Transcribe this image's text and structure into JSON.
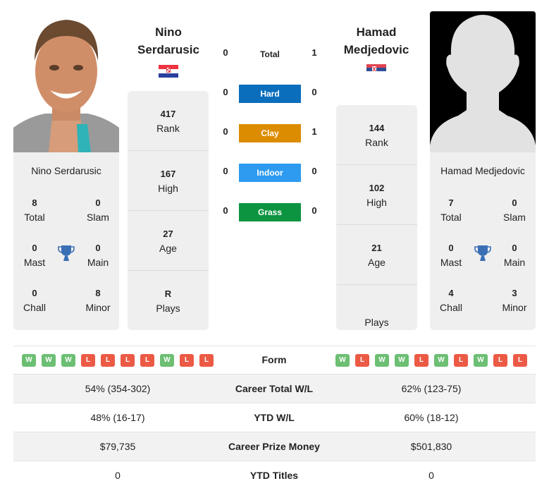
{
  "player_left": {
    "name_line1": "Nino",
    "name_line2": "Serdarusic",
    "full_name": "Nino Serdarusic",
    "country_flag": "croatia-flag",
    "photo": "player-photo",
    "titles": {
      "total": {
        "value": "8",
        "label": "Total"
      },
      "slam": {
        "value": "0",
        "label": "Slam"
      },
      "mast": {
        "value": "0",
        "label": "Mast"
      },
      "main": {
        "value": "0",
        "label": "Main"
      },
      "chall": {
        "value": "0",
        "label": "Chall"
      },
      "minor": {
        "value": "8",
        "label": "Minor"
      }
    },
    "rank": {
      "value": "417",
      "label": "Rank"
    },
    "high": {
      "value": "167",
      "label": "High"
    },
    "age": {
      "value": "27",
      "label": "Age"
    },
    "plays": {
      "value": "R",
      "label": "Plays"
    },
    "form": [
      "W",
      "W",
      "W",
      "L",
      "L",
      "L",
      "L",
      "W",
      "L",
      "L"
    ]
  },
  "player_right": {
    "name_line1": "Hamad",
    "name_line2": "Medjedovic",
    "full_name": "Hamad Medjedovic",
    "country_flag": "serbia-flag",
    "photo": "silhouette-placeholder",
    "titles": {
      "total": {
        "value": "7",
        "label": "Total"
      },
      "slam": {
        "value": "0",
        "label": "Slam"
      },
      "mast": {
        "value": "0",
        "label": "Mast"
      },
      "main": {
        "value": "0",
        "label": "Main"
      },
      "chall": {
        "value": "4",
        "label": "Chall"
      },
      "minor": {
        "value": "3",
        "label": "Minor"
      }
    },
    "rank": {
      "value": "144",
      "label": "Rank"
    },
    "high": {
      "value": "102",
      "label": "High"
    },
    "age": {
      "value": "21",
      "label": "Age"
    },
    "plays": {
      "value": "",
      "label": "Plays"
    },
    "form": [
      "W",
      "L",
      "W",
      "W",
      "L",
      "W",
      "L",
      "W",
      "L",
      "L"
    ]
  },
  "h2h": {
    "total": {
      "label": "Total",
      "left": "0",
      "right": "1"
    },
    "surfaces": [
      {
        "label": "Hard",
        "left": "0",
        "right": "0",
        "color": "#0a6ebd"
      },
      {
        "label": "Clay",
        "left": "0",
        "right": "1",
        "color": "#dc8c00"
      },
      {
        "label": "Indoor",
        "left": "0",
        "right": "0",
        "color": "#2e9bf0"
      },
      {
        "label": "Grass",
        "left": "0",
        "right": "0",
        "color": "#0d9440"
      }
    ]
  },
  "form_label": "Form",
  "colors": {
    "win": "#6cbf73",
    "loss": "#ec5a45",
    "trophy": "#3a6fb5"
  },
  "stats": [
    {
      "label": "Career Total W/L",
      "left": "54% (354-302)",
      "right": "62% (123-75)"
    },
    {
      "label": "YTD W/L",
      "left": "48% (16-17)",
      "right": "60% (18-12)"
    },
    {
      "label": "Career Prize Money",
      "left": "$79,735",
      "right": "$501,830"
    },
    {
      "label": "YTD Titles",
      "left": "0",
      "right": "0"
    }
  ]
}
